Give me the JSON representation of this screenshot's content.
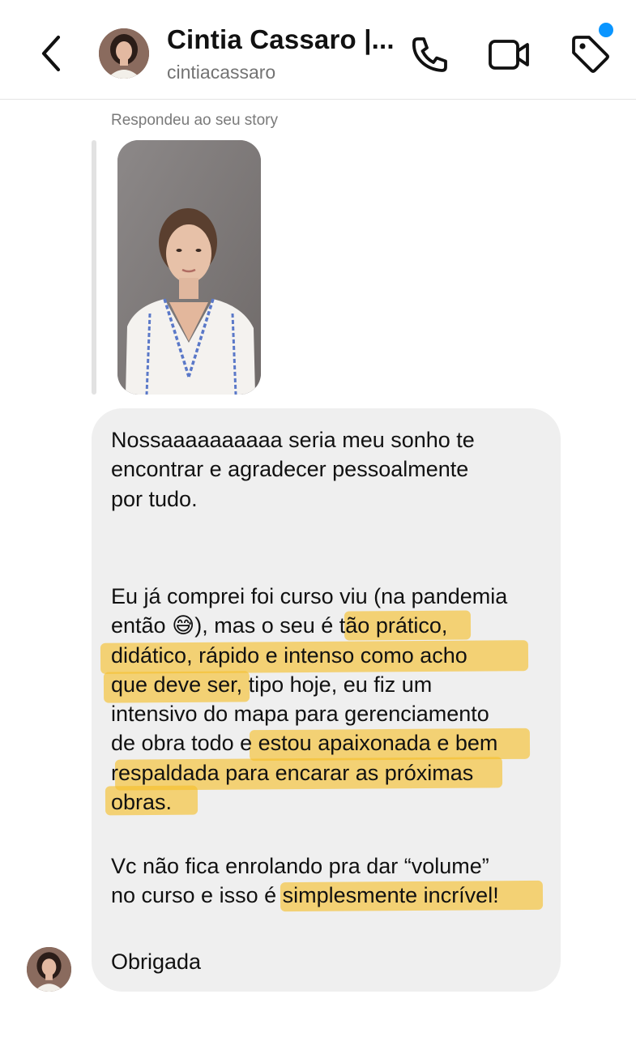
{
  "header": {
    "contact_name": "Cintia Cassaro |...",
    "contact_handle": "cintiacassaro",
    "icons": {
      "back": "chevron-left-icon",
      "call": "phone-icon",
      "video": "video-camera-icon",
      "label": "tag-icon"
    },
    "notification_dot_color": "#0a95ff"
  },
  "story_reply": {
    "label": "Respondeu ao seu story"
  },
  "message": {
    "paragraphs": [
      {
        "lines": [
          "Nossaaaaaaaaaa seria meu sonho te",
          "encontrar e agradecer pessoalmente",
          "por tudo."
        ]
      },
      {
        "lines": [
          "Eu já comprei foi curso viu (na pandemia",
          "então 😅), mas o seu é tão prático,",
          "didático, rápido e intenso como acho",
          "que deve ser, tipo hoje, eu fiz um",
          "intensivo do mapa para gerenciamento",
          "de obra todo e estou apaixonada e bem",
          "respaldada para encarar as próximas",
          "obras."
        ]
      },
      {
        "lines": [
          "Vc não fica enrolando pra dar “volume”",
          "no curso e isso é simplesmente incrível!"
        ]
      },
      {
        "lines": [
          "Obrigada"
        ]
      }
    ],
    "highlight_color": "#f6be28",
    "bubble_color": "#efefef"
  }
}
